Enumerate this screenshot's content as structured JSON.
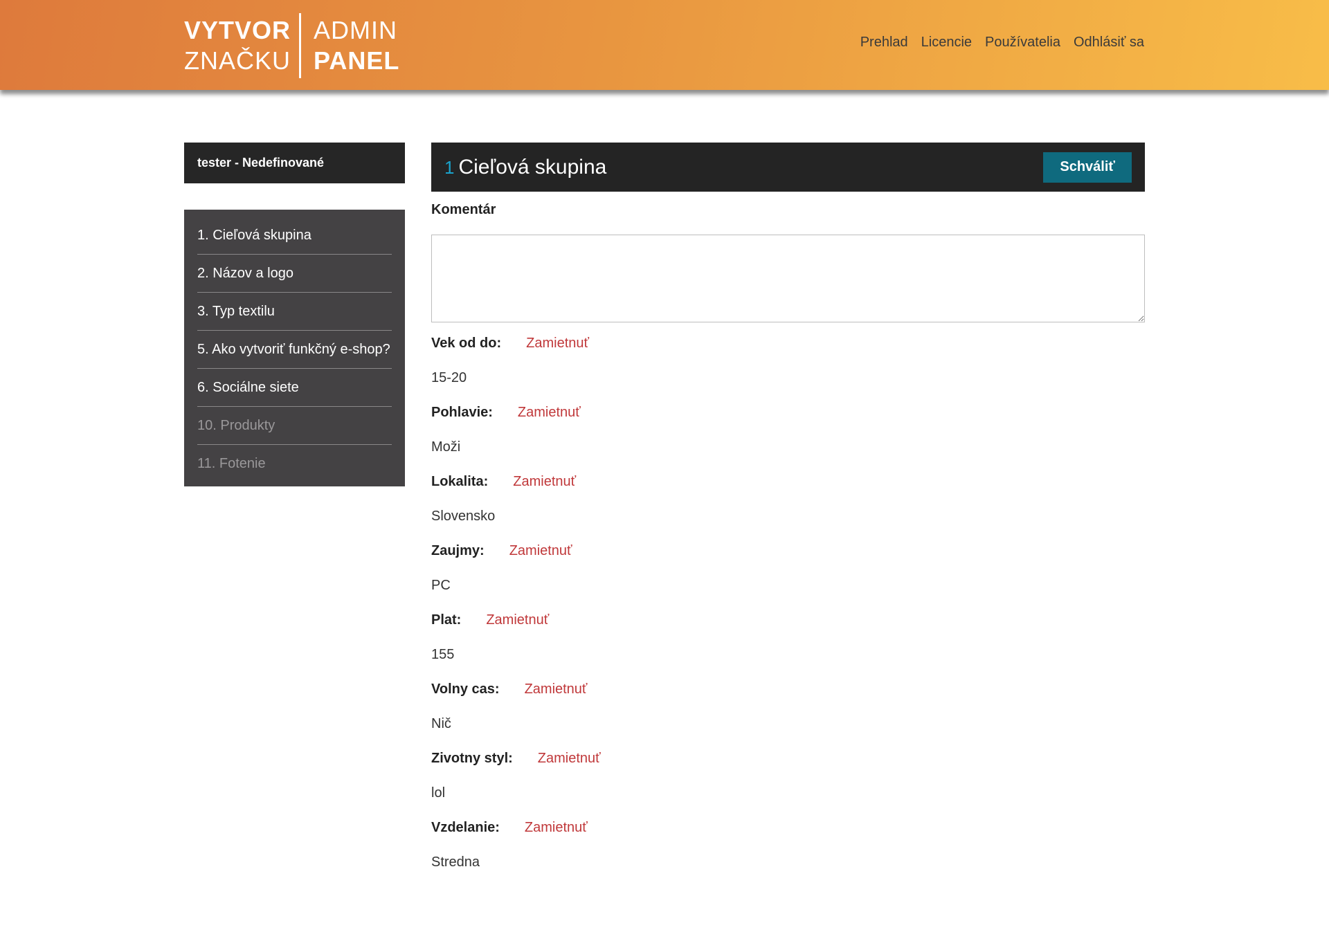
{
  "logo": {
    "line1_left": "VYTVOR",
    "line2_left": "ZNAČKU",
    "line1_right": "ADMIN",
    "line2_right": "PANEL"
  },
  "nav": {
    "items": [
      "Prehlad",
      "Licencie",
      "Používatelia",
      "Odhlásiť sa"
    ]
  },
  "sidebar": {
    "user": "tester - Nedefinované",
    "items": [
      {
        "label": "1. Cieľová skupina",
        "enabled": true
      },
      {
        "label": "2. Názov a logo",
        "enabled": true
      },
      {
        "label": "3. Typ textilu",
        "enabled": true
      },
      {
        "label": "5. Ako vytvoriť funkčný e-shop?",
        "enabled": true
      },
      {
        "label": "6. Sociálne siete",
        "enabled": true
      },
      {
        "label": "10. Produkty",
        "enabled": false
      },
      {
        "label": "11. Fotenie",
        "enabled": false
      }
    ]
  },
  "section": {
    "number": "1",
    "title": "Cieľová skupina",
    "approve_label": "Schváliť",
    "comment_label": "Komentár",
    "comment_value": ""
  },
  "fields": [
    {
      "label": "Vek od do:",
      "action": "Zamietnuť",
      "value": "15-20"
    },
    {
      "label": "Pohlavie:",
      "action": "Zamietnuť",
      "value": "Moži"
    },
    {
      "label": "Lokalita:",
      "action": "Zamietnuť",
      "value": "Slovensko"
    },
    {
      "label": "Zaujmy:",
      "action": "Zamietnuť",
      "value": "PC"
    },
    {
      "label": "Plat:",
      "action": "Zamietnuť",
      "value": "155"
    },
    {
      "label": "Volny cas:",
      "action": "Zamietnuť",
      "value": "Nič"
    },
    {
      "label": "Zivotny styl:",
      "action": "Zamietnuť",
      "value": "lol"
    },
    {
      "label": "Vzdelanie:",
      "action": "Zamietnuť",
      "value": "Stredna"
    }
  ],
  "colors": {
    "header_start": "#de7a3c",
    "header_end": "#f8bd48",
    "approve_button": "#0f6a7e",
    "reject_text": "#c0383a",
    "section_number": "#1aa3cc"
  }
}
